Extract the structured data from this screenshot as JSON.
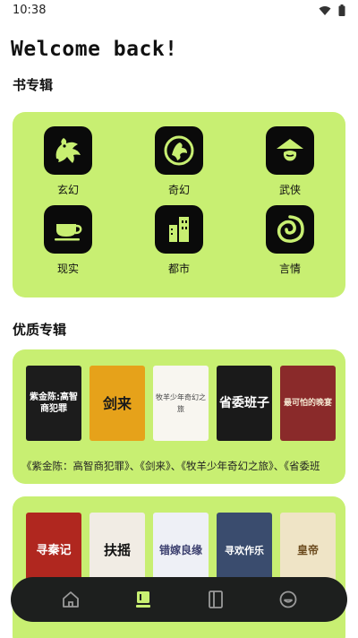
{
  "status": {
    "time": "10:38",
    "icons": [
      "wifi-icon",
      "battery-icon"
    ]
  },
  "header": {
    "welcome": "Welcome back!"
  },
  "categories": {
    "title": "书专辑",
    "items": [
      {
        "label": "玄幻",
        "icon": "dragon-icon"
      },
      {
        "label": "奇幻",
        "icon": "phoenix-icon"
      },
      {
        "label": "武侠",
        "icon": "swordsman-hat-icon"
      },
      {
        "label": "现实",
        "icon": "teacup-icon"
      },
      {
        "label": "都市",
        "icon": "city-buildings-icon"
      },
      {
        "label": "言情",
        "icon": "love-swirl-icon"
      }
    ],
    "accent": "#c8ef72"
  },
  "albums": {
    "title": "优质专辑",
    "album1": {
      "covers": [
        {
          "title": "紫金陈:高智商犯罪",
          "sub": ""
        },
        {
          "title": "剑来",
          "sub": ""
        },
        {
          "title": "牧羊少年奇幻之旅",
          "sub": ""
        },
        {
          "title": "省委班子",
          "sub": ""
        },
        {
          "title": "最可怕的晚宴",
          "sub": ""
        }
      ],
      "desc": "《紫金陈：高智商犯罪》、《剑来》、《牧羊少年奇幻之旅》、《省委班"
    },
    "album2": {
      "covers": [
        {
          "title": "寻秦记",
          "sub": ""
        },
        {
          "title": "扶摇",
          "sub": ""
        },
        {
          "title": "错嫁良缘",
          "sub": ""
        },
        {
          "title": "寻欢作乐",
          "sub": ""
        },
        {
          "title": "皇帝",
          "sub": ""
        }
      ]
    }
  },
  "tabbar": {
    "tabs": [
      {
        "name": "home",
        "icon": "home-icon",
        "active": false
      },
      {
        "name": "library",
        "icon": "book-stack-icon",
        "active": true
      },
      {
        "name": "bookshelf",
        "icon": "book-icon",
        "active": false
      },
      {
        "name": "profile",
        "icon": "smile-icon",
        "active": false
      }
    ]
  }
}
